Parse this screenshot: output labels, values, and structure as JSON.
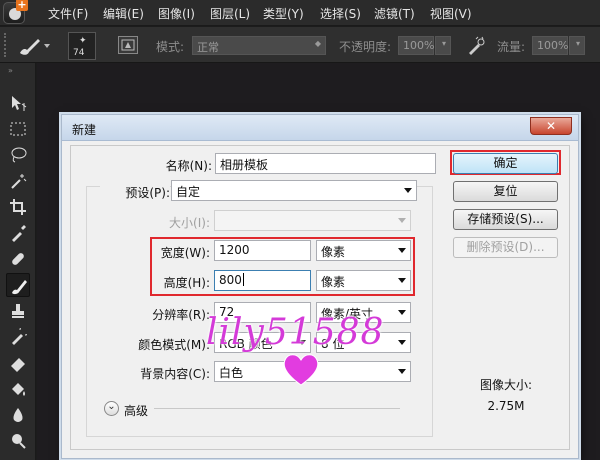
{
  "menubar": {
    "items": [
      "文件(F)",
      "编辑(E)",
      "图像(I)",
      "图层(L)",
      "类型(Y)",
      "选择(S)",
      "滤镜(T)",
      "视图(V)"
    ]
  },
  "options": {
    "brush_size": "74",
    "mode_label": "模式:",
    "mode_value": "正常",
    "opacity_label": "不透明度:",
    "opacity_value": "100%",
    "flow_label": "流量:",
    "flow_value": "100%"
  },
  "dialog": {
    "title": "新建",
    "name_label": "名称(N):",
    "name_value": "相册模板",
    "preset_label": "预设(P):",
    "preset_value": "自定",
    "size_label": "大小(I):",
    "size_value": "",
    "width_label": "宽度(W):",
    "width_value": "1200",
    "width_unit": "像素",
    "height_label": "高度(H):",
    "height_value": "800",
    "height_unit": "像素",
    "resolution_label": "分辨率(R):",
    "resolution_value": "72",
    "resolution_unit": "像素/英寸",
    "color_mode_label": "颜色模式(M):",
    "color_mode_value": "RGB 颜色",
    "color_depth_value": "8 位",
    "background_label": "背景内容(C):",
    "background_value": "白色",
    "advanced_label": "高级",
    "image_size_label": "图像大小:",
    "image_size_value": "2.75M",
    "ok_button": "确定",
    "reset_button": "复位",
    "save_preset_button": "存储预设(S)...",
    "delete_preset_button": "删除预设(D)...",
    "watermark": "lily51588"
  },
  "colors": {
    "highlight_red": "#e0282e",
    "watermark_pink": "#d43ad8"
  }
}
